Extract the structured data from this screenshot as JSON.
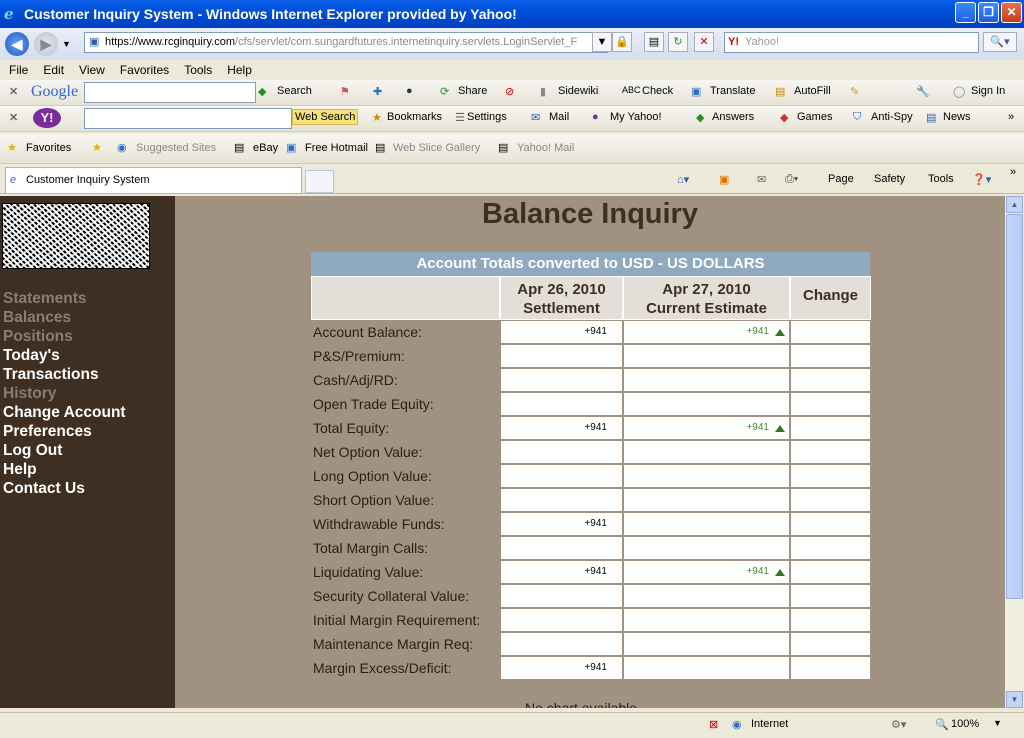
{
  "window": {
    "title": "Customer Inquiry System - Windows Internet Explorer provided by Yahoo!"
  },
  "address": {
    "scheme": "https://www.",
    "host": "rcginquiry.com",
    "path": "/cfs/servlet/com.sungardfutures.internetinquiry.servlets.LoginServlet_F",
    "search_placeholder": "Yahoo!"
  },
  "menu": [
    "File",
    "Edit",
    "View",
    "Favorites",
    "Tools",
    "Help"
  ],
  "google_toolbar": {
    "logo": "Google",
    "search": "Search",
    "share": "Share",
    "sidewiki": "Sidewiki",
    "check": "Check",
    "translate": "Translate",
    "autofill": "AutoFill",
    "signin": "Sign In"
  },
  "yahoo_toolbar": {
    "logo": "Y!",
    "web_search": "Web Search",
    "bookmarks": "Bookmarks",
    "settings": "Settings",
    "mail": "Mail",
    "my_yahoo": "My Yahoo!",
    "answers": "Answers",
    "games": "Games",
    "antispy": "Anti-Spy",
    "news": "News"
  },
  "favorites_bar": {
    "favorites": "Favorites",
    "suggested": "Suggested Sites",
    "ebay": "eBay",
    "hotmail": "Free Hotmail",
    "webslice": "Web Slice Gallery",
    "yahoomail": "Yahoo! Mail"
  },
  "tab": {
    "title": "Customer Inquiry System"
  },
  "commands": {
    "page": "Page",
    "safety": "Safety",
    "tools": "Tools"
  },
  "sidebar": {
    "items": [
      {
        "label": "Statements",
        "active": false
      },
      {
        "label": "Balances",
        "active": false
      },
      {
        "label": "Positions",
        "active": false
      },
      {
        "label": "Today's",
        "active": true
      },
      {
        "label": "Transactions",
        "active": true
      },
      {
        "label": "History",
        "active": false
      },
      {
        "label": "Change Account",
        "active": true
      },
      {
        "label": "Preferences",
        "active": true
      },
      {
        "label": "Log Out",
        "active": true
      },
      {
        "label": "Help",
        "active": true
      },
      {
        "label": "Contact Us",
        "active": true
      }
    ]
  },
  "page": {
    "title": "Balance Inquiry",
    "table_header": "Account Totals converted to USD - US DOLLARS",
    "columns": {
      "settlement_date": "Apr 26, 2010",
      "settlement_label": "Settlement",
      "estimate_date": "Apr 27, 2010",
      "estimate_label": "Current Estimate",
      "change": "Change"
    },
    "rows": [
      {
        "label": "Account Balance:",
        "settlement": "+941",
        "estimate": "+941",
        "up": true,
        "change": ""
      },
      {
        "label": "P&S/Premium:",
        "settlement": "",
        "estimate": "",
        "up": false,
        "change": ""
      },
      {
        "label": "Cash/Adj/RD:",
        "settlement": "",
        "estimate": "",
        "up": false,
        "change": ""
      },
      {
        "label": "Open Trade Equity:",
        "settlement": "",
        "estimate": "",
        "up": false,
        "change": ""
      },
      {
        "label": "Total Equity:",
        "settlement": "+941",
        "estimate": "+941",
        "up": true,
        "change": ""
      },
      {
        "label": "Net Option Value:",
        "settlement": "",
        "estimate": "",
        "up": false,
        "change": ""
      },
      {
        "label": "Long Option Value:",
        "settlement": "",
        "estimate": "",
        "up": false,
        "change": ""
      },
      {
        "label": "Short Option Value:",
        "settlement": "",
        "estimate": "",
        "up": false,
        "change": ""
      },
      {
        "label": "Withdrawable Funds:",
        "settlement": "+941",
        "estimate": "",
        "up": false,
        "change": ""
      },
      {
        "label": "Total Margin Calls:",
        "settlement": "",
        "estimate": "",
        "up": false,
        "change": ""
      },
      {
        "label": "Liquidating Value:",
        "settlement": "+941",
        "estimate": "+941",
        "up": true,
        "change": ""
      },
      {
        "label": "Security Collateral Value:",
        "settlement": "",
        "estimate": "",
        "up": false,
        "change": ""
      },
      {
        "label": "Initial Margin Requirement:",
        "settlement": "",
        "estimate": "",
        "up": false,
        "change": ""
      },
      {
        "label": "Maintenance Margin Req:",
        "settlement": "",
        "estimate": "",
        "up": false,
        "change": ""
      },
      {
        "label": "Margin Excess/Deficit:",
        "settlement": "+941",
        "estimate": "",
        "up": false,
        "change": ""
      }
    ],
    "chart_note": "No chart available"
  },
  "status": {
    "zone": "Internet",
    "zoom": "100%"
  }
}
